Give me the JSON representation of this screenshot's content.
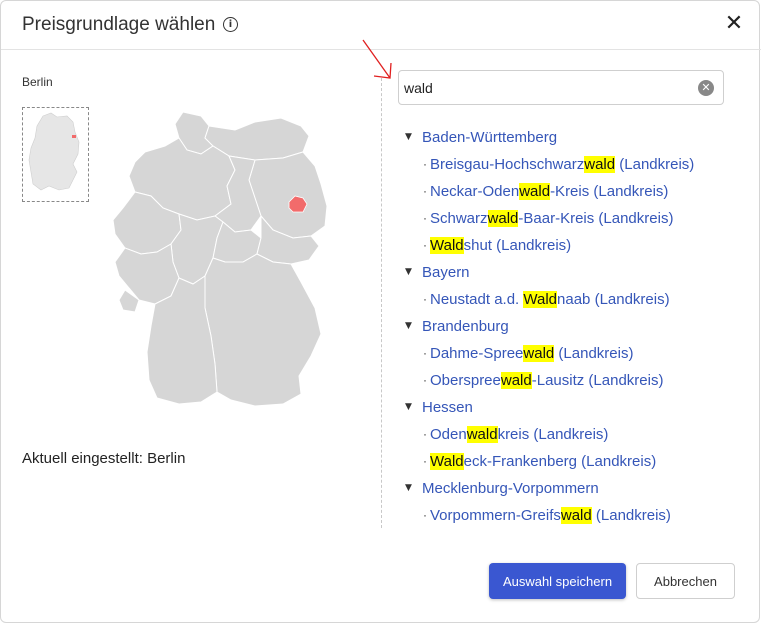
{
  "dialog": {
    "title": "Preisgrundlage wählen",
    "info_icon": "info-icon",
    "close_icon": "close-icon",
    "close_glyph": "✕"
  },
  "left": {
    "region_label": "Berlin",
    "current_label": "Aktuell eingestellt: Berlin",
    "map_fill_color": "#d6d6d6",
    "map_highlight_color": "#f26b6b"
  },
  "search": {
    "value": "wald",
    "clear_glyph": "✕"
  },
  "tree": {
    "highlight_term": "wald",
    "groups": [
      {
        "state": "Baden-Württemberg",
        "districts": [
          {
            "pre": "Breisgau-Hochschwarz",
            "match": "wald",
            "post": " (Landkreis)"
          },
          {
            "pre": "Neckar-Oden",
            "match": "wald",
            "post": "-Kreis (Landkreis)"
          },
          {
            "pre": "Schwarz",
            "match": "wald",
            "post": "-Baar-Kreis (Landkreis)"
          },
          {
            "pre": "",
            "match": "Wald",
            "post": "shut (Landkreis)"
          }
        ]
      },
      {
        "state": "Bayern",
        "districts": [
          {
            "pre": "Neustadt a.d. ",
            "match": "Wald",
            "post": "naab (Landkreis)"
          }
        ]
      },
      {
        "state": "Brandenburg",
        "districts": [
          {
            "pre": "Dahme-Spree",
            "match": "wald",
            "post": " (Landkreis)"
          },
          {
            "pre": "Oberspree",
            "match": "wald",
            "post": "-Lausitz (Landkreis)"
          }
        ]
      },
      {
        "state": "Hessen",
        "districts": [
          {
            "pre": "Oden",
            "match": "wald",
            "post": "kreis (Landkreis)"
          },
          {
            "pre": "",
            "match": "Wald",
            "post": "eck-Frankenberg (Landkreis)"
          }
        ]
      },
      {
        "state": "Mecklenburg-Vorpommern",
        "districts": [
          {
            "pre": "Vorpommern-Greifs",
            "match": "wald",
            "post": " (Landkreis)"
          }
        ]
      }
    ]
  },
  "buttons": {
    "save_label": "Auswahl speichern",
    "cancel_label": "Abbrechen"
  },
  "colors": {
    "primary": "#3a57d1",
    "link": "#3556b8",
    "highlight": "#ffff00",
    "annotation_arrow": "#e02020"
  }
}
